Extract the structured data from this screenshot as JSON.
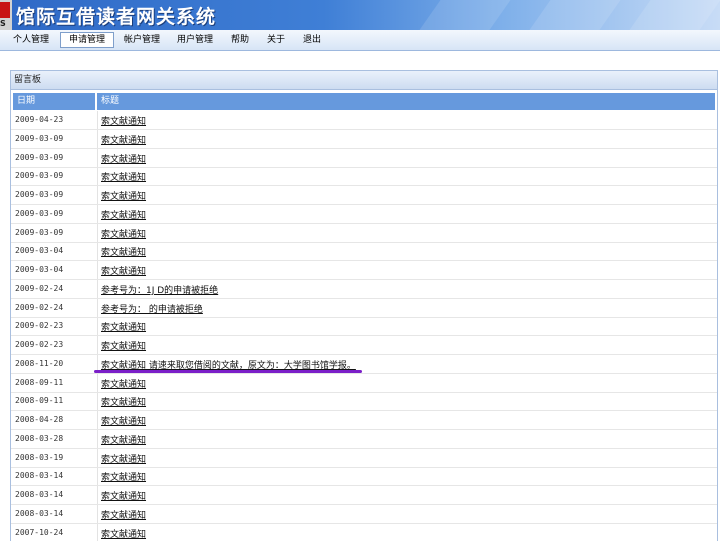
{
  "app": {
    "title": "馆际互借读者网关系统",
    "logo_text": "S"
  },
  "nav": {
    "items": [
      {
        "label": "个人管理"
      },
      {
        "label": "申请管理",
        "active": true
      },
      {
        "label": "帐户管理"
      },
      {
        "label": "用户管理"
      },
      {
        "label": "帮助"
      },
      {
        "label": "关于"
      },
      {
        "label": "退出"
      }
    ]
  },
  "panel": {
    "title": "留言板"
  },
  "table": {
    "headers": {
      "date": "日期",
      "title": "标题"
    },
    "rows": [
      {
        "date": "2009-04-23",
        "title": "索文献通知"
      },
      {
        "date": "2009-03-09",
        "title": "索文献通知"
      },
      {
        "date": "2009-03-09",
        "title": "索文献通知"
      },
      {
        "date": "2009-03-09",
        "title": "索文献通知"
      },
      {
        "date": "2009-03-09",
        "title": "索文献通知"
      },
      {
        "date": "2009-03-09",
        "title": "索文献通知"
      },
      {
        "date": "2009-03-09",
        "title": "索文献通知"
      },
      {
        "date": "2009-03-04",
        "title": "索文献通知"
      },
      {
        "date": "2009-03-04",
        "title": "索文献通知"
      },
      {
        "date": "2009-02-24",
        "title": "参考号为：1J D的申请被拒绝"
      },
      {
        "date": "2009-02-24",
        "title": "参考号为： 的申请被拒绝"
      },
      {
        "date": "2009-02-23",
        "title": "索文献通知"
      },
      {
        "date": "2009-02-23",
        "title": "索文献通知"
      },
      {
        "date": "2008-11-20",
        "title": "索文献通知 请速来取您借阅的文献，原文为：大学图书馆学报。"
      },
      {
        "date": "2008-09-11",
        "title": "索文献通知"
      },
      {
        "date": "2008-09-11",
        "title": "索文献通知"
      },
      {
        "date": "2008-04-28",
        "title": "索文献通知"
      },
      {
        "date": "2008-03-28",
        "title": "索文献通知"
      },
      {
        "date": "2008-03-19",
        "title": "索文献通知"
      },
      {
        "date": "2008-03-14",
        "title": "索文献通知"
      },
      {
        "date": "2008-03-14",
        "title": "索文献通知"
      },
      {
        "date": "2008-03-14",
        "title": "索文献通知"
      },
      {
        "date": "2007-10-24",
        "title": "索文献通知"
      }
    ]
  },
  "colors": {
    "banner": "#3f7fd6",
    "header_bg": "#6699dd",
    "annotation": "#7b1fc8"
  }
}
